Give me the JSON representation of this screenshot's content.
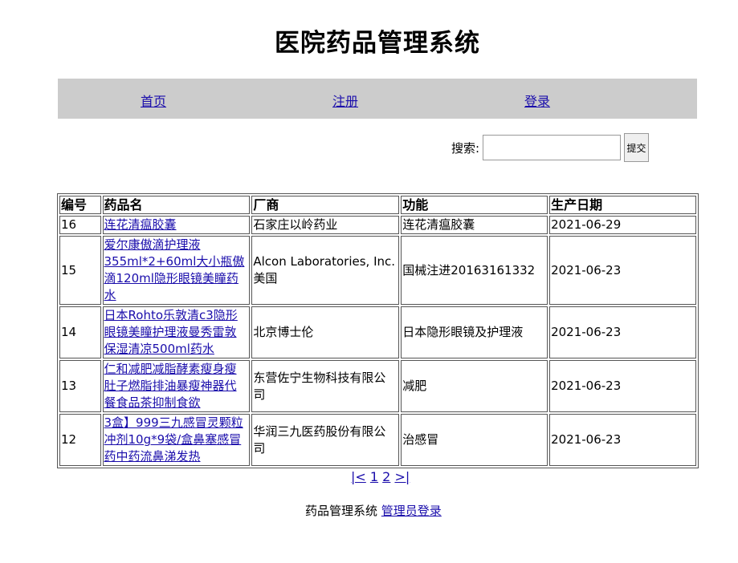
{
  "header": {
    "title": "医院药品管理系统"
  },
  "nav": {
    "home": "首页",
    "register": "注册",
    "login": "登录"
  },
  "search": {
    "label": "搜索:",
    "placeholder": "",
    "value": "",
    "submit": "提交"
  },
  "table": {
    "columns": [
      "编号",
      "药品名",
      "厂商",
      "功能",
      "生产日期"
    ],
    "rows": [
      {
        "id": "16",
        "name": "连花清瘟胶囊",
        "maker": "石家庄以岭药业",
        "function": "连花清瘟胶囊",
        "date": "2021-06-29"
      },
      {
        "id": "15",
        "name": "爱尔康傲滴护理液355ml*2+60ml大小瓶傲滴120ml隐形眼镜美瞳药水",
        "maker": "Alcon Laboratories, Inc. 美国",
        "function": "国械注进20163161332",
        "date": "2021-06-23"
      },
      {
        "id": "14",
        "name": "日本Rohto乐敦清c3隐形眼镜美瞳护理液曼秀雷敦保湿清凉500ml药水",
        "maker": "北京博士伦",
        "function": "日本隐形眼镜及护理液",
        "date": "2021-06-23"
      },
      {
        "id": "13",
        "name": "仁和减肥减脂酵素瘦身瘦肚子燃脂排油暴瘦神器代餐食品茶抑制食欲",
        "maker": "东营佐宁生物科技有限公司",
        "function": "减肥",
        "date": "2021-06-23"
      },
      {
        "id": "12",
        "name": "3盒】999三九感冒灵颗粒冲剂10g*9袋/盒鼻塞感冒药中药流鼻涕发热",
        "maker": "华润三九医药股份有限公司",
        "function": "治感冒",
        "date": "2021-06-23"
      }
    ]
  },
  "pager": {
    "first": "|<",
    "page1": "1",
    "page2": "2",
    "last": ">|"
  },
  "footer": {
    "text": "药品管理系统",
    "admin_login": "管理员登录"
  }
}
